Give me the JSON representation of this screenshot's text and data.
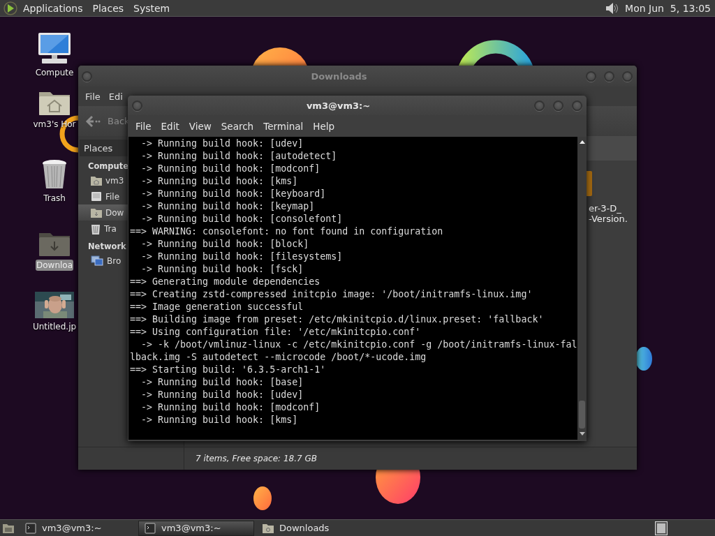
{
  "top_panel": {
    "menus": [
      "Applications",
      "Places",
      "System"
    ],
    "clock": "Mon Jun  5, 13:05"
  },
  "desktop_icons": [
    {
      "kind": "computer",
      "label": "Compute",
      "selected": false
    },
    {
      "kind": "home",
      "label": "vm3's Hor",
      "selected": false
    },
    {
      "kind": "trash",
      "label": "Trash",
      "selected": false
    },
    {
      "kind": "downloads",
      "label": "Downloa",
      "selected": true
    },
    {
      "label": "Untitled.jp",
      "selected": false
    }
  ],
  "file_manager": {
    "title": "Downloads",
    "menu": [
      "File",
      "Edi"
    ],
    "back": "Back",
    "sidebar": {
      "heading": "Places",
      "sections": [
        {
          "heading": "Compute",
          "items": [
            {
              "kind": "home",
              "label": "vm3",
              "selected": false
            },
            {
              "kind": "drive",
              "label": "File",
              "selected": false
            },
            {
              "kind": "downloads",
              "label": "Dow",
              "selected": true
            },
            {
              "kind": "trash",
              "label": "Tra",
              "selected": false
            }
          ]
        },
        {
          "heading": "Network",
          "items": [
            {
              "kind": "network",
              "label": "Bro",
              "selected": false
            }
          ]
        }
      ]
    },
    "file_name_lines": [
      "er-3-D_",
      "-Version."
    ],
    "status": "7 items, Free space: 18.7 GB"
  },
  "terminal": {
    "title": "vm3@vm3:~",
    "menu": [
      "File",
      "Edit",
      "View",
      "Search",
      "Terminal",
      "Help"
    ],
    "lines": [
      "  -> Running build hook: [udev]",
      "  -> Running build hook: [autodetect]",
      "  -> Running build hook: [modconf]",
      "  -> Running build hook: [kms]",
      "  -> Running build hook: [keyboard]",
      "  -> Running build hook: [keymap]",
      "  -> Running build hook: [consolefont]",
      "==> WARNING: consolefont: no font found in configuration",
      "  -> Running build hook: [block]",
      "  -> Running build hook: [filesystems]",
      "  -> Running build hook: [fsck]",
      "==> Generating module dependencies",
      "==> Creating zstd-compressed initcpio image: '/boot/initramfs-linux.img'",
      "==> Image generation successful",
      "==> Building image from preset: /etc/mkinitcpio.d/linux.preset: 'fallback'",
      "==> Using configuration file: '/etc/mkinitcpio.conf'",
      "  -> -k /boot/vmlinuz-linux -c /etc/mkinitcpio.conf -g /boot/initramfs-linux-fal",
      "lback.img -S autodetect --microcode /boot/*-ucode.img",
      "==> Starting build: '6.3.5-arch1-1'",
      "  -> Running build hook: [base]",
      "  -> Running build hook: [udev]",
      "  -> Running build hook: [modconf]",
      "  -> Running build hook: [kms]"
    ]
  },
  "taskbar": {
    "tasks": [
      {
        "kind": "terminal",
        "label": "vm3@vm3:~",
        "selected": false
      },
      {
        "kind": "terminal",
        "label": "vm3@vm3:~",
        "selected": true
      },
      {
        "kind": "folder",
        "label": "Downloads",
        "selected": false
      }
    ]
  }
}
